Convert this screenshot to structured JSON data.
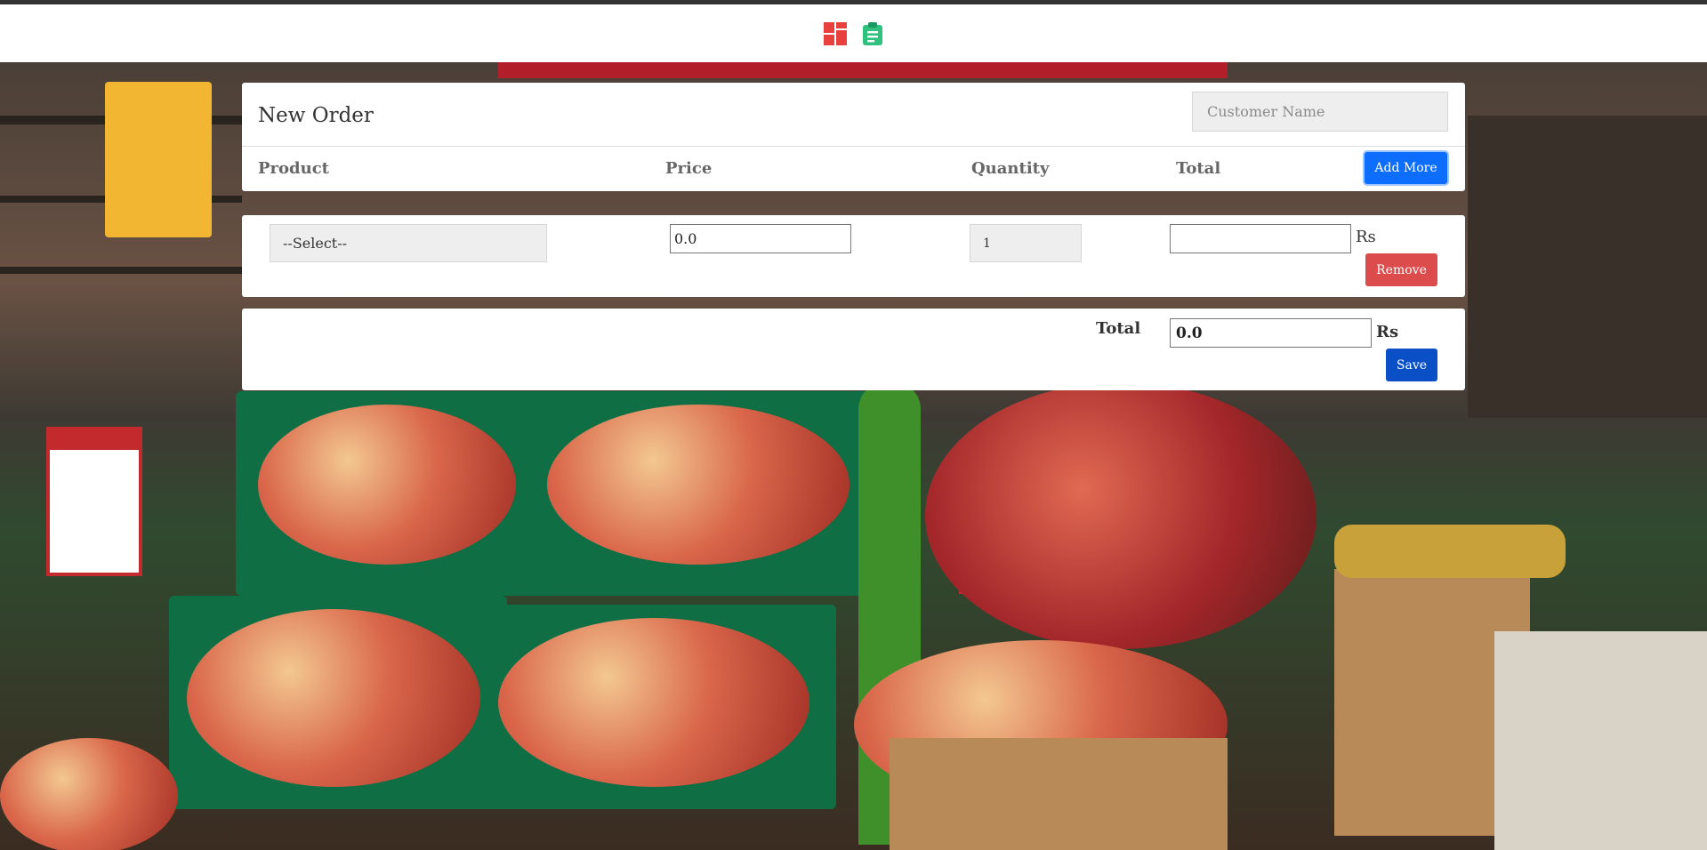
{
  "nav": {
    "icons": [
      "dashboard-icon",
      "clipboard-icon"
    ],
    "colors": {
      "dashboard": "#e8403c",
      "clipboard": "#2ec27e"
    }
  },
  "order": {
    "title": "New Order",
    "customer_placeholder": "Customer Name",
    "columns": {
      "product": "Product",
      "price": "Price",
      "quantity": "Quantity",
      "total": "Total"
    },
    "add_more_label": "Add More"
  },
  "line_item": {
    "product_selected": "--Select--",
    "price": "0.0",
    "quantity": "1",
    "total": "",
    "currency": "Rs",
    "remove_label": "Remove"
  },
  "summary": {
    "total_label": "Total",
    "grand_total": "0.0",
    "currency": "Rs",
    "save_label": "Save"
  },
  "colors": {
    "add_more": "#0d6efd",
    "remove": "#dc4c4c",
    "save": "#0b4fc7"
  }
}
